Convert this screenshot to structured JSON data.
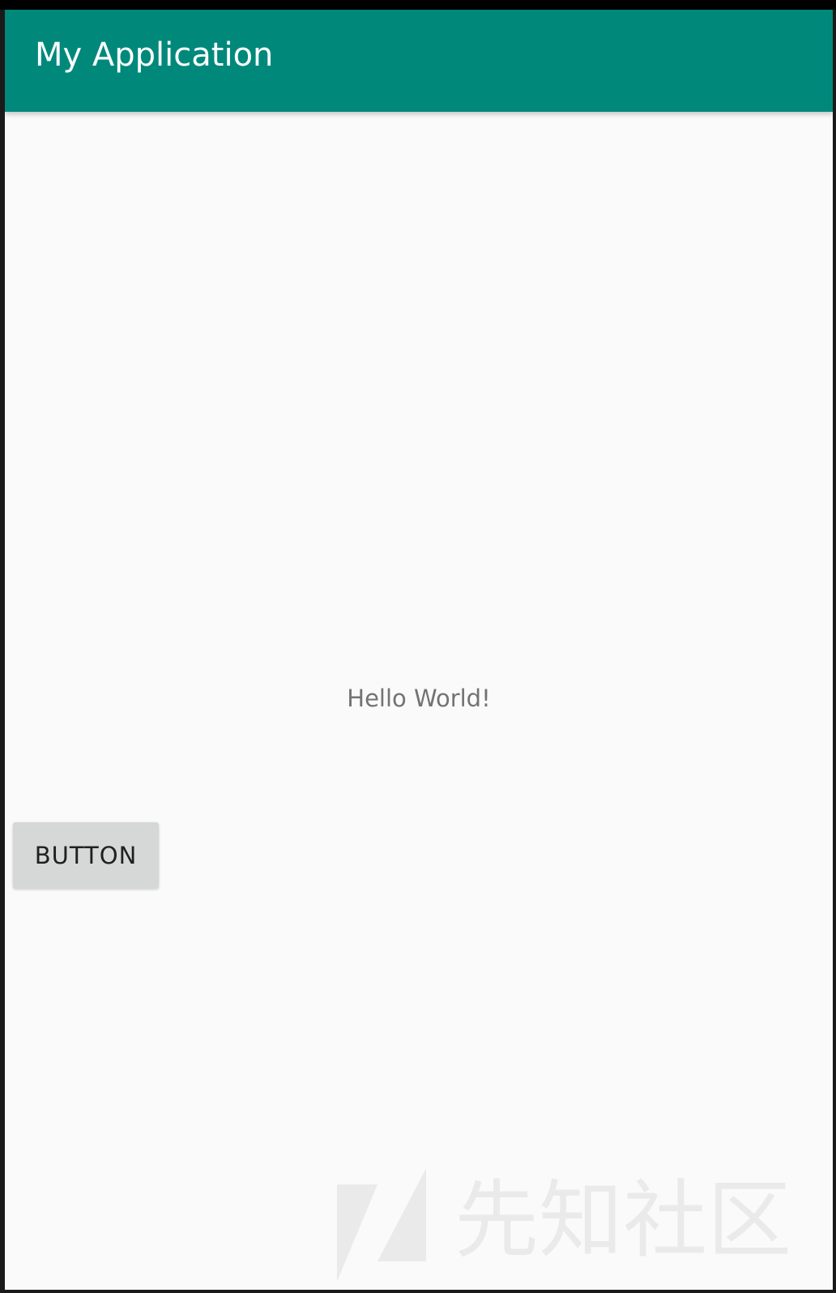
{
  "app_bar": {
    "title": "My Application",
    "color": "#00897b"
  },
  "content": {
    "hello_text": "Hello World!",
    "button_label": "BUTTON"
  },
  "watermark": {
    "text": "先知社区"
  }
}
